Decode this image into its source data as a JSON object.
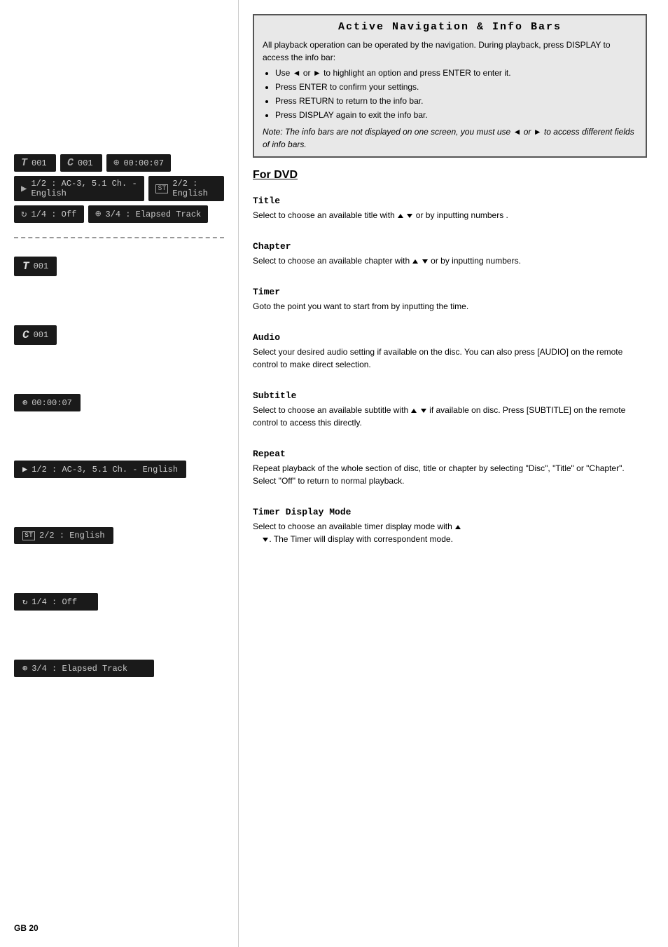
{
  "page": {
    "page_number": "GB 20"
  },
  "right_col": {
    "info_bar": {
      "title": "Active  Navigation  &  Info  Bars",
      "body_intro": "All playback operation can be operated by the navigation. During playback, press DISPLAY to access the info bar:",
      "bullets": [
        "Use ◄ or ► to highlight an option and press ENTER to enter it.",
        "Press ENTER to confirm your settings.",
        "Press RETURN to return to the info bar.",
        "Press DISPLAY again to exit the info bar."
      ],
      "note": "Note: The info bars are not displayed on one screen, you must use ◄ or ► to access different fields of info bars."
    },
    "for_dvd_label": "For DVD",
    "sections": [
      {
        "id": "title",
        "heading": "Title",
        "body": "Select to choose an available title with ▲   ▼ or by inputting numbers ."
      },
      {
        "id": "chapter",
        "heading": "Chapter",
        "body": "Select to choose an available chapter with ▲   ▼ or by inputting numbers."
      },
      {
        "id": "timer",
        "heading": "Timer",
        "body": "Goto the point you want to start from by inputting the time."
      },
      {
        "id": "audio",
        "heading": "Audio",
        "body": "Select your desired audio setting if available on the disc. You can also press [AUDIO] on the remote control to make direct selection."
      },
      {
        "id": "subtitle",
        "heading": "Subtitle",
        "body": "Select to choose an available subtitle with ▲   ▼ if available on disc. Press [SUBTITLE] on the remote control to access this directly."
      },
      {
        "id": "repeat",
        "heading": "Repeat",
        "body": "Repeat playback of the whole section of disc, title or chapter by selecting \"Disc\", \"Title\" or \"Chapter\". Select \"Off\" to return to normal playback."
      },
      {
        "id": "timer_display",
        "heading": "Timer  Display  Mode",
        "body": "Select to choose an available timer display mode with ▲   ▼. The Timer will display with correspondent mode."
      }
    ]
  },
  "left_col": {
    "overview_row1": {
      "title_icon": "T",
      "title_val": "001",
      "chapter_icon": "C",
      "chapter_val": "001",
      "timer_icon": "⊕",
      "timer_val": "00:00:07"
    },
    "overview_row2": {
      "audio_icon": "🔊",
      "audio_val": "1/2 : AC-3, 5.1 Ch. - English",
      "subtitle_icon": "ST",
      "subtitle_val": "2/2 : English"
    },
    "overview_row3": {
      "repeat_icon": "🔁",
      "repeat_val": "1/4 : Off",
      "timer_icon": "⊕",
      "timer_val": "3/4 : Elapsed Track"
    },
    "detail_items": [
      {
        "icon": "T",
        "value": "001",
        "type": "title"
      },
      {
        "icon": "C",
        "value": "001",
        "type": "chapter"
      },
      {
        "icon": "⊕",
        "value": "00:00:07",
        "type": "timer"
      },
      {
        "icon": "🔊",
        "value": "1/2 : AC-3, 5.1 Ch. - English",
        "type": "audio"
      },
      {
        "icon": "ST",
        "value": "2/2 : English",
        "type": "subtitle"
      },
      {
        "icon": "🔁",
        "value": "1/4 : Off",
        "type": "repeat"
      },
      {
        "icon": "⊕",
        "value": "3/4 : Elapsed Track",
        "type": "timer-display"
      }
    ]
  }
}
